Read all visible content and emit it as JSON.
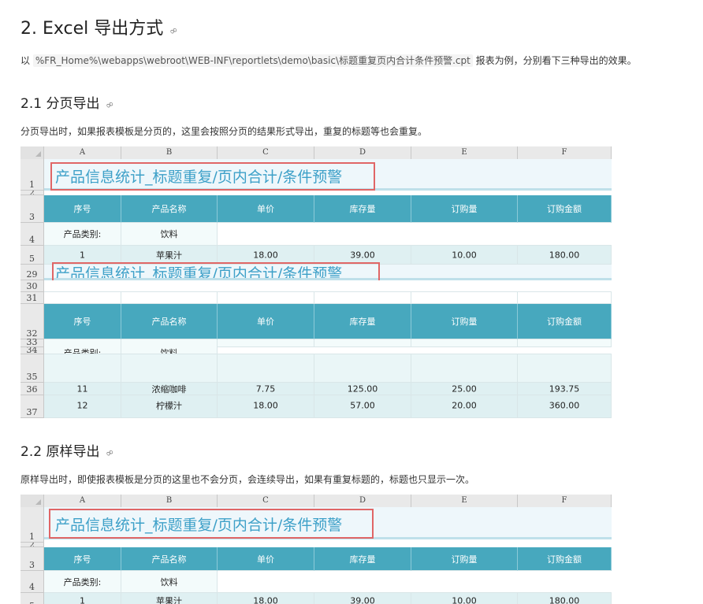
{
  "heading_main": "2. Excel 导出方式",
  "intro": {
    "prefix": "以 ",
    "path": "%FR_Home%\\webapps\\webroot\\WEB-INF\\reportlets\\demo\\basic\\标题重复页内合计条件预警.cpt",
    "suffix": " 报表为例，分别看下三种导出的效果。"
  },
  "section1": {
    "heading": "2.1 分页导出",
    "desc": "分页导出时，如果报表模板是分页的，这里会按照分页的结果形式导出，重复的标题等也会重复。"
  },
  "section2": {
    "heading": "2.2 原样导出",
    "desc": "原样导出时，即使报表模板是分页的这里也不会分页，会连续导出，如果有重复标题的，标题也只显示一次。"
  },
  "sheet": {
    "columns": [
      "A",
      "B",
      "C",
      "D",
      "E",
      "F"
    ],
    "title": "产品信息统计_标题重复/页内合计/条件预警",
    "headers": [
      "序号",
      "产品名称",
      "单价",
      "库存量",
      "订购量",
      "订购金额"
    ],
    "category_label": "产品类别:",
    "category_value": "饮料",
    "rows_sheet1": {
      "r1": "1",
      "r2": "2",
      "r3": "3",
      "r4": "4",
      "r5": "5",
      "r29": "29",
      "r30": "30",
      "r31": "31",
      "r32": "32",
      "r33": "33",
      "r34": "34",
      "r35": "35",
      "r36": "36",
      "r37": "37"
    },
    "data_row1": [
      "1",
      "苹果汁",
      "18.00",
      "39.00",
      "10.00",
      "180.00"
    ],
    "data_row11": [
      "11",
      "浓缩咖啡",
      "7.75",
      "125.00",
      "25.00",
      "193.75"
    ],
    "data_row12": [
      "12",
      "柠檬汁",
      "18.00",
      "57.00",
      "20.00",
      "360.00"
    ]
  },
  "link_icon": "link-icon",
  "colors": {
    "teal": "#47a8be",
    "title": "#3da0c8",
    "highlight": "#e06666"
  }
}
